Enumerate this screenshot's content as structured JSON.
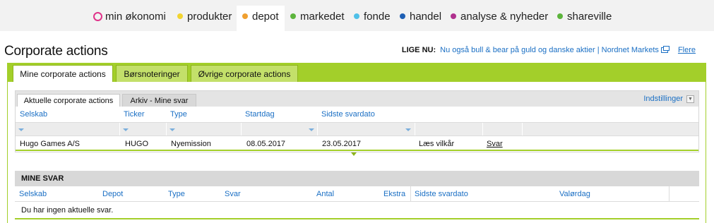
{
  "nav": {
    "items": [
      {
        "label": "min økonomi",
        "color": "#e0338a"
      },
      {
        "label": "produkter",
        "color": "#f2d430"
      },
      {
        "label": "depot",
        "color": "#f0a030"
      },
      {
        "label": "markedet",
        "color": "#5cb43c"
      },
      {
        "label": "fonde",
        "color": "#4fc0e8"
      },
      {
        "label": "handel",
        "color": "#1e5fb4"
      },
      {
        "label": "analyse & nyheder",
        "color": "#b0308e"
      },
      {
        "label": "shareville",
        "color": "#5cb43c"
      }
    ],
    "active": "depot"
  },
  "header": {
    "title": "Corporate actions",
    "live_label": "LIGE NU:",
    "live_news": "Nu også bull & bear på guld og danske aktier | Nordnet Markets",
    "more_label": "Flere"
  },
  "main_tabs": [
    "Mine corporate actions",
    "Børsnoteringer",
    "Øvrige corporate actions"
  ],
  "panel1": {
    "tabs": [
      "Aktuelle corporate actions",
      "Arkiv - Mine svar"
    ],
    "settings_label": "Indstillinger",
    "columns": [
      "Selskab",
      "Ticker",
      "Type",
      "Startdag",
      "Sidste svardato"
    ],
    "rows": [
      {
        "company": "Hugo Games A/S",
        "ticker": "HUGO",
        "type": "Nyemission",
        "start": "08.05.2017",
        "last": "23.05.2017",
        "terms": "Læs vilkår",
        "answer": "Svar"
      }
    ]
  },
  "panel2": {
    "title": "MINE SVAR",
    "columns": [
      "Selskab",
      "Depot",
      "Type",
      "Svar",
      "Antal",
      "Ekstra",
      "Sidste svardato",
      "Valørdag"
    ],
    "empty_text": "Du har ingen aktuelle svar."
  },
  "colors": {
    "accent": "#a3cf2a",
    "link": "#1a6fc4"
  }
}
